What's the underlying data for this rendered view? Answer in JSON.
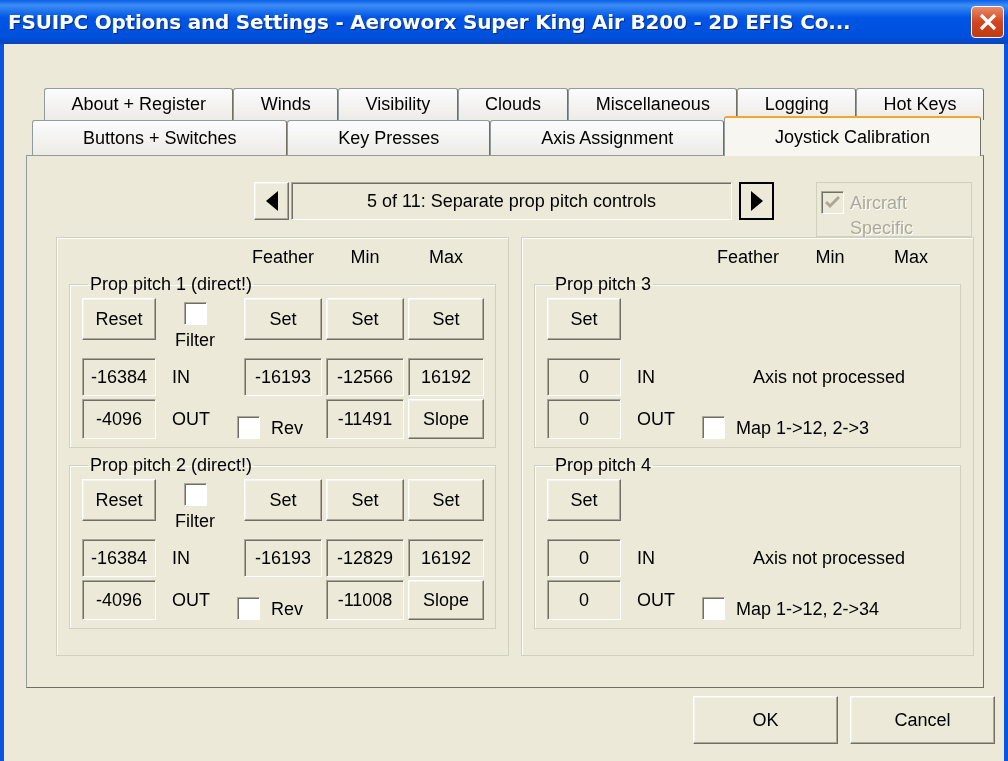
{
  "window": {
    "title": "FSUIPC Options and Settings - Aeroworx Super King Air B200 - 2D EFIS Co..."
  },
  "tabs": {
    "rows": [
      {
        "tabs": [
          {
            "label": "About + Register",
            "selected": false
          },
          {
            "label": "Winds",
            "selected": false
          },
          {
            "label": "Visibility",
            "selected": false
          },
          {
            "label": "Clouds",
            "selected": false
          },
          {
            "label": "Miscellaneous",
            "selected": false
          },
          {
            "label": "Logging",
            "selected": false
          },
          {
            "label": "Hot Keys",
            "selected": false
          }
        ]
      },
      {
        "tabs": [
          {
            "label": "Buttons + Switches",
            "selected": false
          },
          {
            "label": "Key Presses",
            "selected": false
          },
          {
            "label": "Axis Assignment",
            "selected": false
          },
          {
            "label": "Joystick Calibration",
            "selected": true
          }
        ]
      }
    ]
  },
  "page_selector": {
    "value": "5 of 11: Separate prop pitch controls"
  },
  "aircraft_specific": {
    "label": "Aircraft Specific",
    "checked": true,
    "disabled": true
  },
  "panels": [
    {
      "headers": [
        "Feather",
        "Min",
        "Max"
      ],
      "groups": [
        {
          "kind": "calibrated",
          "title": "Prop pitch 1 (direct!)",
          "reset": "Reset",
          "filter": {
            "label": "Filter",
            "checked": false
          },
          "set_buttons": [
            "Set",
            "Set",
            "Set"
          ],
          "in": {
            "value": "-16384",
            "label": "IN"
          },
          "out": {
            "value": "-4096",
            "label": "OUT"
          },
          "in_values": [
            "-16193",
            "-12566",
            "16192"
          ],
          "rev": {
            "label": "Rev",
            "checked": false
          },
          "min_out": "-11491",
          "slope": "Slope"
        },
        {
          "kind": "calibrated",
          "title": "Prop pitch 2 (direct!)",
          "reset": "Reset",
          "filter": {
            "label": "Filter",
            "checked": false
          },
          "set_buttons": [
            "Set",
            "Set",
            "Set"
          ],
          "in": {
            "value": "-16384",
            "label": "IN"
          },
          "out": {
            "value": "-4096",
            "label": "OUT"
          },
          "in_values": [
            "-16193",
            "-12829",
            "16192"
          ],
          "rev": {
            "label": "Rev",
            "checked": false
          },
          "min_out": "-11008",
          "slope": "Slope"
        }
      ]
    },
    {
      "headers": [
        "Feather",
        "Min",
        "Max"
      ],
      "groups": [
        {
          "kind": "unprocessed",
          "title": "Prop pitch 3",
          "set": "Set",
          "in": {
            "value": "0",
            "label": "IN"
          },
          "out": {
            "value": "0",
            "label": "OUT"
          },
          "status": "Axis not processed",
          "map": {
            "label": "Map 1->12, 2->3",
            "checked": false
          }
        },
        {
          "kind": "unprocessed",
          "title": "Prop pitch 4",
          "set": "Set",
          "in": {
            "value": "0",
            "label": "IN"
          },
          "out": {
            "value": "0",
            "label": "OUT"
          },
          "status": "Axis not processed",
          "map": {
            "label": "Map 1->12, 2->34",
            "checked": false
          }
        }
      ]
    }
  ],
  "buttons": [
    {
      "label": "OK"
    },
    {
      "label": "Cancel"
    }
  ]
}
